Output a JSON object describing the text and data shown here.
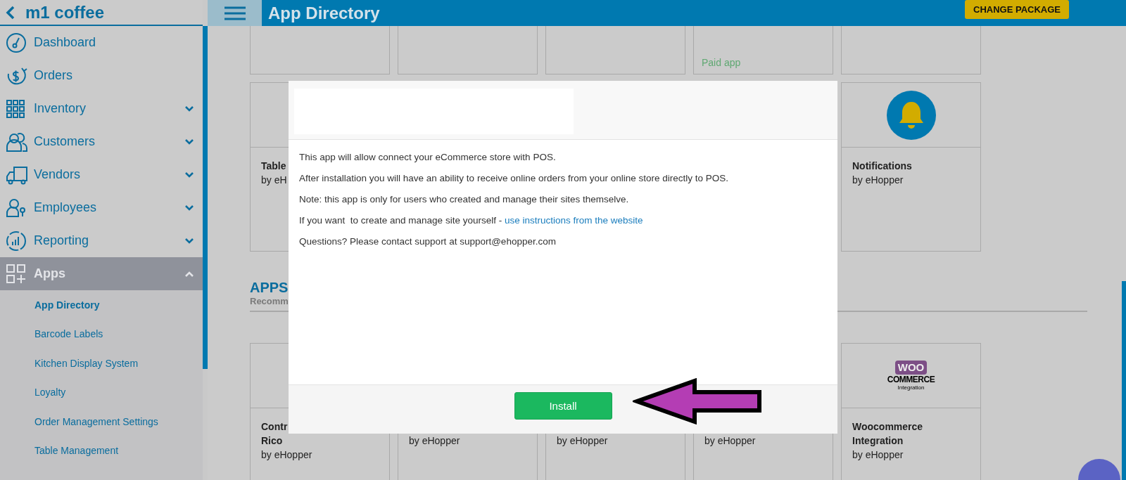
{
  "sidebar": {
    "store_name": "m1 coffee",
    "items": [
      {
        "label": "Dashboard",
        "kind": "link",
        "selected": false
      },
      {
        "label": "Orders",
        "kind": "link",
        "selected": false
      },
      {
        "label": "Inventory",
        "kind": "group",
        "expanded": false,
        "selected": false
      },
      {
        "label": "Customers",
        "kind": "group",
        "expanded": false,
        "selected": false
      },
      {
        "label": "Vendors",
        "kind": "group",
        "expanded": false,
        "selected": false
      },
      {
        "label": "Employees",
        "kind": "group",
        "expanded": false,
        "selected": false
      },
      {
        "label": "Reporting",
        "kind": "group",
        "expanded": false,
        "selected": false
      },
      {
        "label": "Apps",
        "kind": "group",
        "expanded": true,
        "selected": true
      }
    ],
    "subitems": [
      {
        "label": "App Directory",
        "selected": true
      },
      {
        "label": "Barcode Labels",
        "selected": false
      },
      {
        "label": "Kitchen Display System",
        "selected": false
      },
      {
        "label": "Loyalty",
        "selected": false
      },
      {
        "label": "Order Management Settings",
        "selected": false
      },
      {
        "label": "Table Management",
        "selected": false
      }
    ]
  },
  "topbar": {
    "title": "App Directory",
    "button": "CHANGE PACKAGE"
  },
  "cards_row_1": [
    {
      "kind": "blank"
    },
    {
      "kind": "blank"
    },
    {
      "kind": "blank"
    },
    {
      "kind": "paid",
      "badge": "Paid app"
    },
    {
      "kind": "blank"
    }
  ],
  "cards_row_2": [
    {
      "kind": "plain",
      "title": [
        "Table"
      ],
      "byline": "by eH"
    },
    {
      "kind": "bell",
      "title": [
        "Notifications"
      ],
      "byline": "by eHopper"
    }
  ],
  "apps_section": {
    "heading": "APPS",
    "subheading": "Recomm"
  },
  "cards_row_3": [
    {
      "kind": "plain",
      "title": [
        "Contr",
        "Rico"
      ],
      "byline": "by eHopper"
    },
    {
      "kind": "plain",
      "byline": "by eHopper"
    },
    {
      "kind": "plain",
      "byline": "by eHopper"
    },
    {
      "kind": "plain",
      "byline": "by eHopper"
    },
    {
      "kind": "logo",
      "logo": {
        "mark": "WOO",
        "word": "COMMERCE",
        "caption": "Integration"
      },
      "title": [
        "Woocommerce",
        "Integration"
      ],
      "byline": "by eHopper"
    }
  ],
  "modal": {
    "paragraphs": [
      {
        "text": "This app will allow connect your eCommerce store with POS."
      },
      {
        "text": "After installation you will have an ability to receive online orders from your online store directly to POS."
      },
      {
        "text": "Note: this app is only for users who created and manage their sites themselve."
      },
      {
        "text": "If you want  to create and manage site yourself - ",
        "link": "use instructions from the website"
      },
      {
        "text": "Questions? Please contact support at support@ehopper.com"
      }
    ],
    "button": "Install"
  }
}
